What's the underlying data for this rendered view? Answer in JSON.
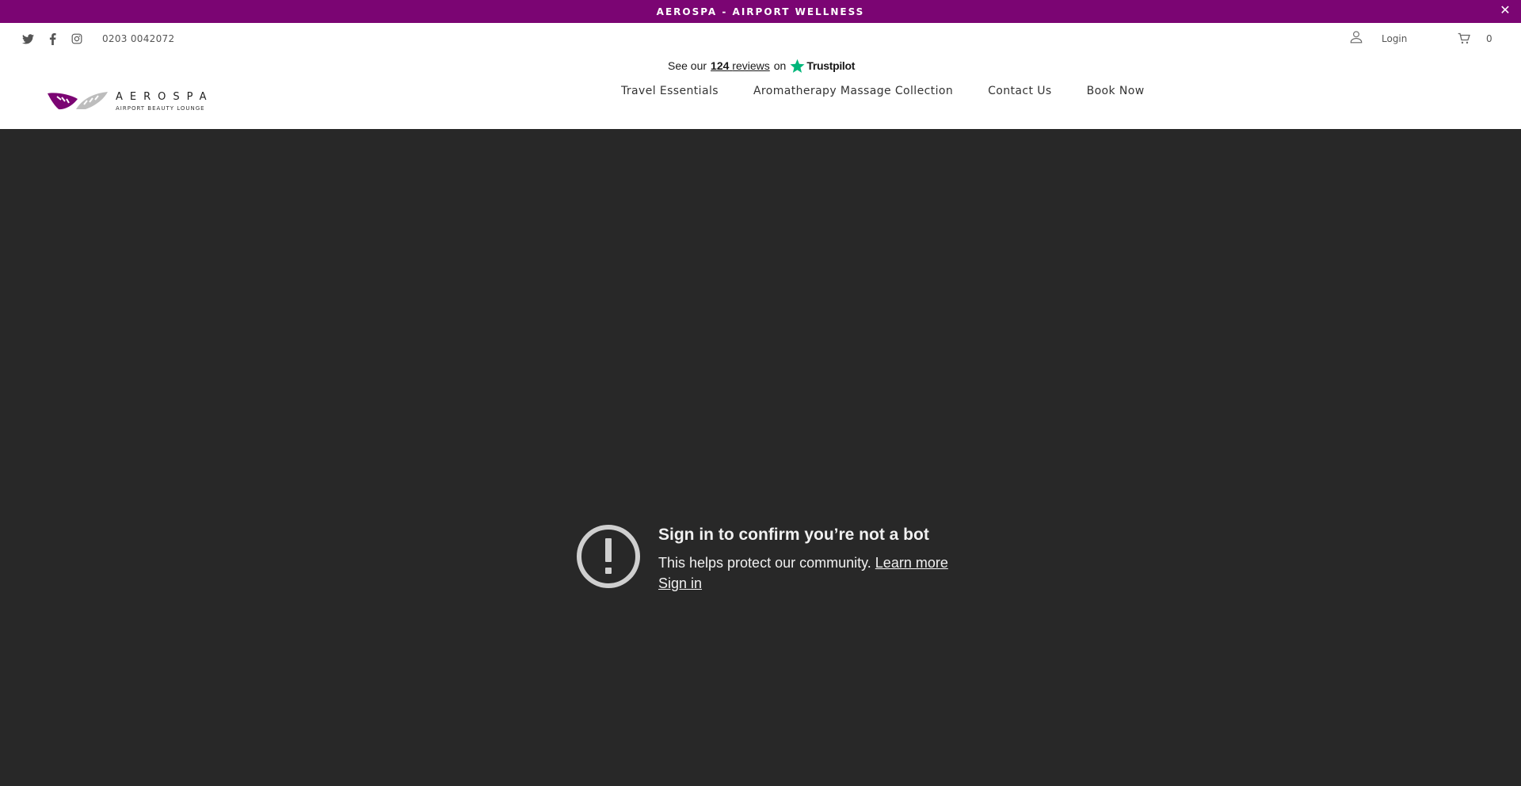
{
  "announcement": {
    "text": "AEROSPA - AIRPORT WELLNESS",
    "close_icon": "close-icon",
    "background": "#7b0573"
  },
  "header": {
    "social": [
      "twitter-icon",
      "facebook-icon",
      "instagram-icon"
    ],
    "phone": "0203 0042072",
    "account_icon": "user-icon",
    "login_label": "Login",
    "cart_icon": "cart-icon",
    "cart_count": "0",
    "trustpilot": {
      "prefix": "See our",
      "count": "124",
      "reviews_word": "reviews",
      "on": "on",
      "brand": "Trustpilot",
      "star_color": "#00b67a"
    },
    "logo": {
      "name": "AEROSPA",
      "tagline": "AIRPORT BEAUTY LOUNGE",
      "brand_color": "#7b0573"
    },
    "nav": [
      {
        "label": "Travel Essentials"
      },
      {
        "label": "Aromatherapy Massage Collection"
      },
      {
        "label": "Contact Us"
      },
      {
        "label": "Book Now"
      }
    ]
  },
  "embed": {
    "background": "#282828",
    "icon": "alert-circle-icon",
    "title": "Sign in to confirm you’re not a bot",
    "subtitle": "This helps protect our community.",
    "learn_more": "Learn more",
    "sign_in": "Sign in"
  }
}
